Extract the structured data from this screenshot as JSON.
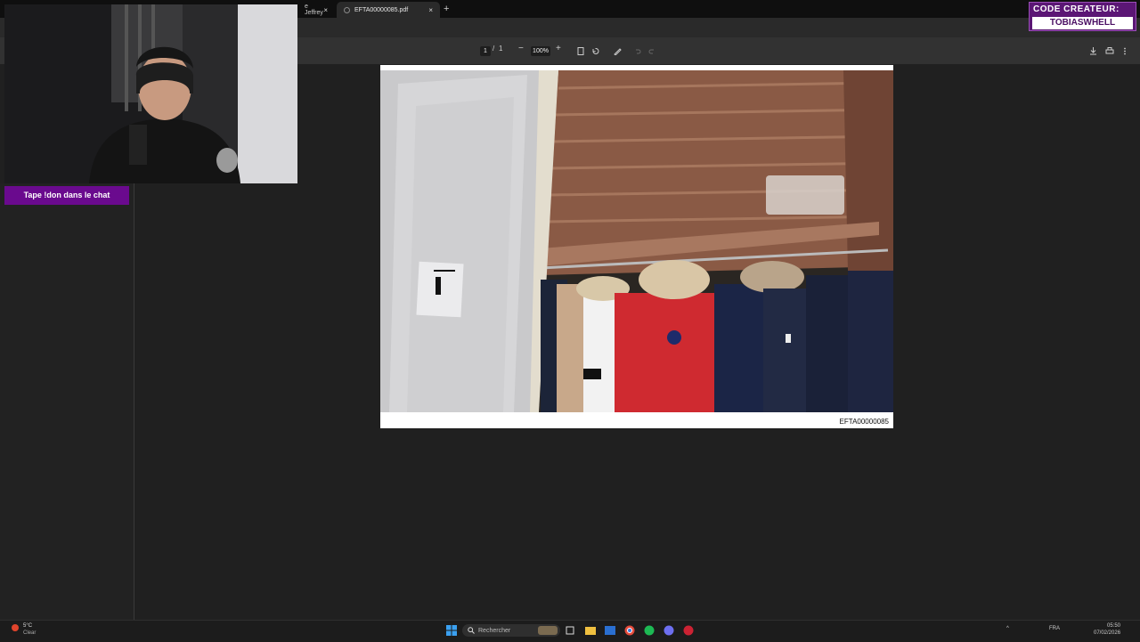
{
  "browser": {
    "tabs": [
      {
        "label": "e Jeffrey",
        "close": "×"
      },
      {
        "label": "EFTA00000085.pdf",
        "close": "×"
      }
    ],
    "new_tab": "+"
  },
  "pdf_toolbar": {
    "page_current": "1",
    "page_separator": "/",
    "page_total": "1",
    "zoom_minus": "−",
    "zoom": "100%",
    "zoom_plus": "+"
  },
  "document": {
    "id": "EFTA00000085"
  },
  "overlay": {
    "cta": "Tape !don dans le chat",
    "creator_line1": "CODE CREATEUR:",
    "creator_line2": "TOBIASWHELL"
  },
  "taskbar": {
    "weather_temp": "5°C",
    "weather_desc": "Clear",
    "search_placeholder": "Rechercher",
    "lang": "FRA",
    "time": "05:50",
    "date": "07/02/2026"
  }
}
